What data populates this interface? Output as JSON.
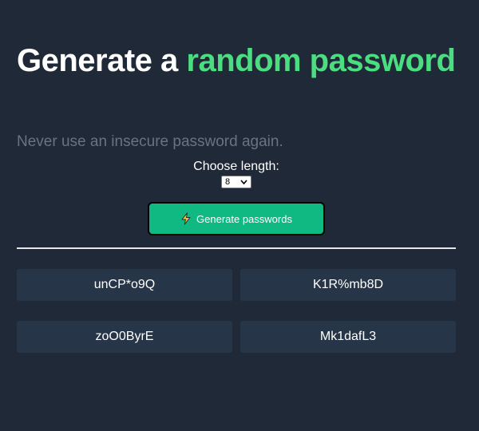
{
  "header": {
    "title_part1": "Generate a ",
    "title_accent": "random password",
    "subtitle": "Never use an insecure password again."
  },
  "length": {
    "label": "Choose length:",
    "selected": "8"
  },
  "generate_button": {
    "label": "Generate passwords",
    "icon": "lightning-bolt-icon"
  },
  "passwords": [
    "unCP*o9Q",
    "K1R%mb8D",
    "zoO0ByrE",
    "Mk1dafL3"
  ],
  "colors": {
    "background": "#1f2937",
    "accent": "#4ade80",
    "button": "#10b981",
    "card": "#273549",
    "muted_text": "#6b7280"
  }
}
